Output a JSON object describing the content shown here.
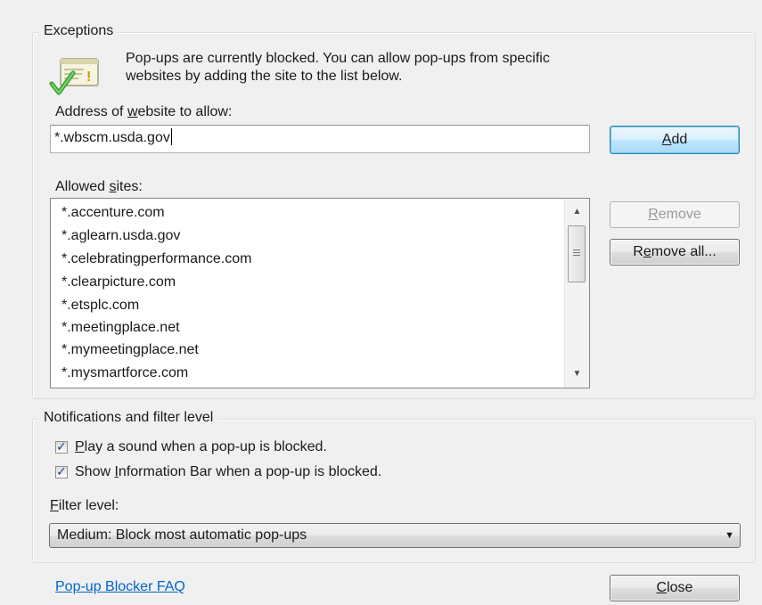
{
  "exceptions": {
    "legend": "Exceptions",
    "info_line1": "Pop-ups are currently blocked.  You can allow pop-ups from specific",
    "info_line2": "websites by adding the site to the list below.",
    "address_label_pre": "Address of ",
    "address_label_accel": "w",
    "address_label_post": "ebsite to allow:",
    "address_value": "*.wbscm.usda.gov",
    "add_pre": "",
    "add_accel": "A",
    "add_post": "dd",
    "allowed_label_pre": "Allowed ",
    "allowed_label_accel": "s",
    "allowed_label_post": "ites:",
    "allowed_sites": [
      "*.accenture.com",
      "*.aglearn.usda.gov",
      "*.celebratingperformance.com",
      "*.clearpicture.com",
      "*.etsplc.com",
      "*.meetingplace.net",
      "*.mymeetingplace.net",
      "*.mysmartforce.com"
    ],
    "remove_pre": "",
    "remove_accel": "R",
    "remove_post": "emove",
    "remove_all_pre": "R",
    "remove_all_accel": "e",
    "remove_all_post": "move all..."
  },
  "notifications": {
    "legend": "Notifications and filter level",
    "play_sound_pre": "",
    "play_sound_accel": "P",
    "play_sound_post": "lay a sound when a pop-up is blocked.",
    "play_sound_checked": true,
    "show_bar_pre": "Show ",
    "show_bar_accel": "I",
    "show_bar_post": "nformation Bar when a pop-up is blocked.",
    "show_bar_checked": true,
    "filter_label_pre": "",
    "filter_label_accel": "F",
    "filter_label_post": "ilter level:",
    "filter_value": "Medium: Block most automatic pop-ups"
  },
  "footer": {
    "faq_link": "Pop-up Blocker FAQ",
    "close_pre": "",
    "close_accel": "C",
    "close_post": "lose"
  },
  "icons": {
    "info_icon": "popup-shield-check-icon",
    "scroll_up": "scroll-up-arrow-icon",
    "scroll_down": "scroll-down-arrow-icon",
    "dropdown": "chevron-down-icon"
  },
  "colors": {
    "link": "#0066cc",
    "default_button_border": "#3c7fb1",
    "check_mark": "#1c3f87"
  }
}
